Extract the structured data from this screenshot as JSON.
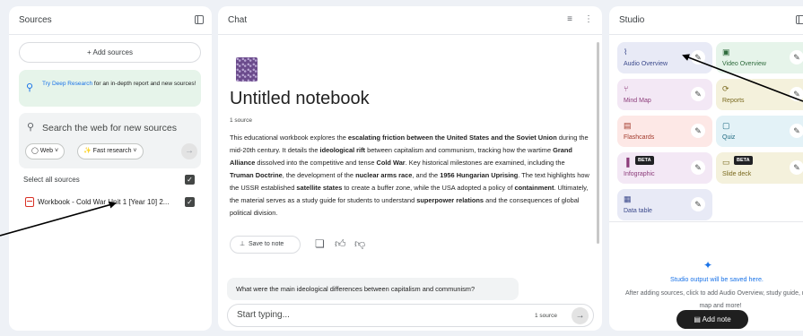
{
  "sources": {
    "title": "Sources",
    "add_sources": "+ Add sources",
    "deep_research_link": "Try Deep Research",
    "deep_research_text": " for an in-depth report and new sources!",
    "search_placeholder": "Search the web for new sources",
    "web_chip": "Web",
    "fast_research_chip": "Fast research",
    "select_all": "Select all sources",
    "items": [
      {
        "label": "Workbook - Cold War Unit 1 [Year 10] 2...",
        "checked": true
      }
    ]
  },
  "chat": {
    "title": "Chat",
    "notebook_title": "Untitled notebook",
    "source_count": "1 source",
    "summary_segments": [
      {
        "t": "This educational workbook explores the ",
        "b": false
      },
      {
        "t": "escalating friction between the United States and the Soviet Union",
        "b": true
      },
      {
        "t": " during the mid-20th century. It details the ",
        "b": false
      },
      {
        "t": "ideological rift",
        "b": true
      },
      {
        "t": " between capitalism and communism, tracking how the wartime ",
        "b": false
      },
      {
        "t": "Grand Alliance",
        "b": true
      },
      {
        "t": " dissolved into the competitive and tense ",
        "b": false
      },
      {
        "t": "Cold War",
        "b": true
      },
      {
        "t": ". Key historical milestones are examined, including the ",
        "b": false
      },
      {
        "t": "Truman Doctrine",
        "b": true
      },
      {
        "t": ", the development of the ",
        "b": false
      },
      {
        "t": "nuclear arms race",
        "b": true
      },
      {
        "t": ", and the ",
        "b": false
      },
      {
        "t": "1956 Hungarian Uprising",
        "b": true
      },
      {
        "t": ". The text highlights how the USSR established ",
        "b": false
      },
      {
        "t": "satellite states",
        "b": true
      },
      {
        "t": " to create a buffer zone, while the USA adopted a policy of ",
        "b": false
      },
      {
        "t": "containment",
        "b": true
      },
      {
        "t": ". Ultimately, the material serves as a study guide for students to understand ",
        "b": false
      },
      {
        "t": "superpower relations",
        "b": true
      },
      {
        "t": " and the consequences of global political division.",
        "b": false
      }
    ],
    "save_to_note": "Save to note",
    "suggestion": "What were the main ideological differences between capitalism and communism?",
    "composer_placeholder": "Start typing...",
    "composer_sources": "1 source"
  },
  "studio": {
    "title": "Studio",
    "cards": [
      {
        "label": "Audio Overview",
        "icon": "waveform-icon",
        "bg": "#e8eaf6",
        "color": "#3c4a8c"
      },
      {
        "label": "Video Overview",
        "icon": "video-icon",
        "bg": "#e6f4ea",
        "color": "#2e6b3c"
      },
      {
        "label": "Mind Map",
        "icon": "mind-map-icon",
        "bg": "#f3e8f5",
        "color": "#8c3c7a"
      },
      {
        "label": "Reports",
        "icon": "reports-icon",
        "bg": "#f4f1dc",
        "color": "#7a6a1f"
      },
      {
        "label": "Flashcards",
        "icon": "flashcards-icon",
        "bg": "#fde8e6",
        "color": "#a33a2c"
      },
      {
        "label": "Quiz",
        "icon": "quiz-icon",
        "bg": "#e3f2f7",
        "color": "#1f6a80"
      },
      {
        "label": "Infographic",
        "icon": "infographic-icon",
        "bg": "#f3e8f5",
        "color": "#8c3c7a",
        "badge": "BETA"
      },
      {
        "label": "Slide deck",
        "icon": "slides-icon",
        "bg": "#f4f1dc",
        "color": "#7a6a1f",
        "badge": "BETA"
      },
      {
        "label": "Data table",
        "icon": "table-icon",
        "bg": "#e8eaf6",
        "color": "#3c4a8c"
      }
    ],
    "saved_here": "Studio output will be saved here.",
    "after_adding": "After adding sources, click to add Audio Overview, study guide, mind map and more!",
    "add_note": "Add note"
  }
}
